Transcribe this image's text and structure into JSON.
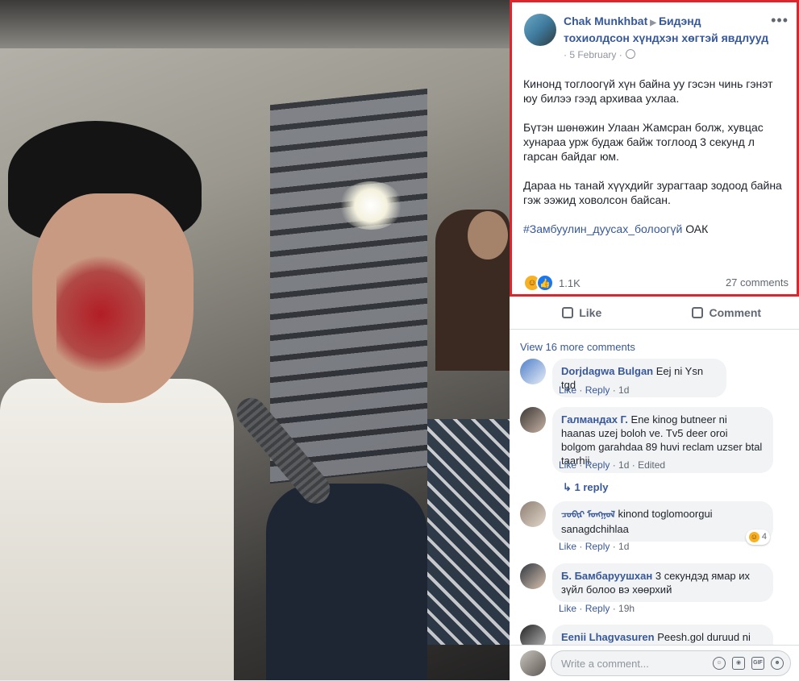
{
  "post": {
    "author": "Chak Munkhbat",
    "group": "Бидэнд тохиолдсон хүндхэн хөгтэй явдлууд",
    "date": "5 February",
    "more_icon": "ellipsis-icon",
    "paragraphs": [
      "Кинонд тоглоогүй хүн байна уу гэсэн чинь гэнэт юу билээ гээд архиваа ухлаа.",
      "Бүтэн шөнөжин Улаан Жамсран болж, хувцас хунараа урж будаж байж тоглоод 3 секунд л гарсан байдаг юм.",
      "Дараа нь танай хүүхдийг зурагтаар зодоод байна гэж ээжид ховолсон байсан."
    ],
    "hashtag": "#Замбуулин_дуусах_болоогүй",
    "tag_suffix": " ОАК",
    "reactions": "1.1K",
    "comments_count": "27 comments"
  },
  "actions": {
    "like": "Like",
    "comment": "Comment"
  },
  "view_more": "View 16 more comments",
  "comments": [
    {
      "name": "Dorjdagwa Bulgan",
      "text": "Eej ni Ysn tgd",
      "like": "Like",
      "reply": "Reply",
      "time": "1d"
    },
    {
      "name": "Галмандах Г.",
      "text": "Ene kinog butneer ni haanas uzej boloh ve. Tv5 deer oroi bolgom garahdaa 89 huvi reclam uzser btal taarhii",
      "like": "Like",
      "reply": "Reply",
      "time": "1d",
      "edited": "Edited",
      "replies": "1 reply"
    },
    {
      "name": "ᠴᠣᠪᠢᠷ ᠮᠣᠩᠭᠣᠯ",
      "text": "kinond toglomoorgui sanagdchihlaa",
      "like": "Like",
      "reply": "Reply",
      "time": "1d",
      "reaction_count": "4"
    },
    {
      "name": "Б. Бамбаруушхан",
      "text": "3 секундэд ямар их зүйл болоо вэ хөөрхий",
      "like": "Like",
      "reply": "Reply",
      "time": "19h"
    },
    {
      "name": "Eenii Lhagvasuren",
      "text": "Peesh.gol duruud ni"
    }
  ],
  "composer": {
    "placeholder": "Write a comment..."
  },
  "colors": {
    "link": "#365899",
    "highlight": "#e0242c",
    "like_blue": "#1877f2",
    "haha_yellow": "#f7b125"
  }
}
